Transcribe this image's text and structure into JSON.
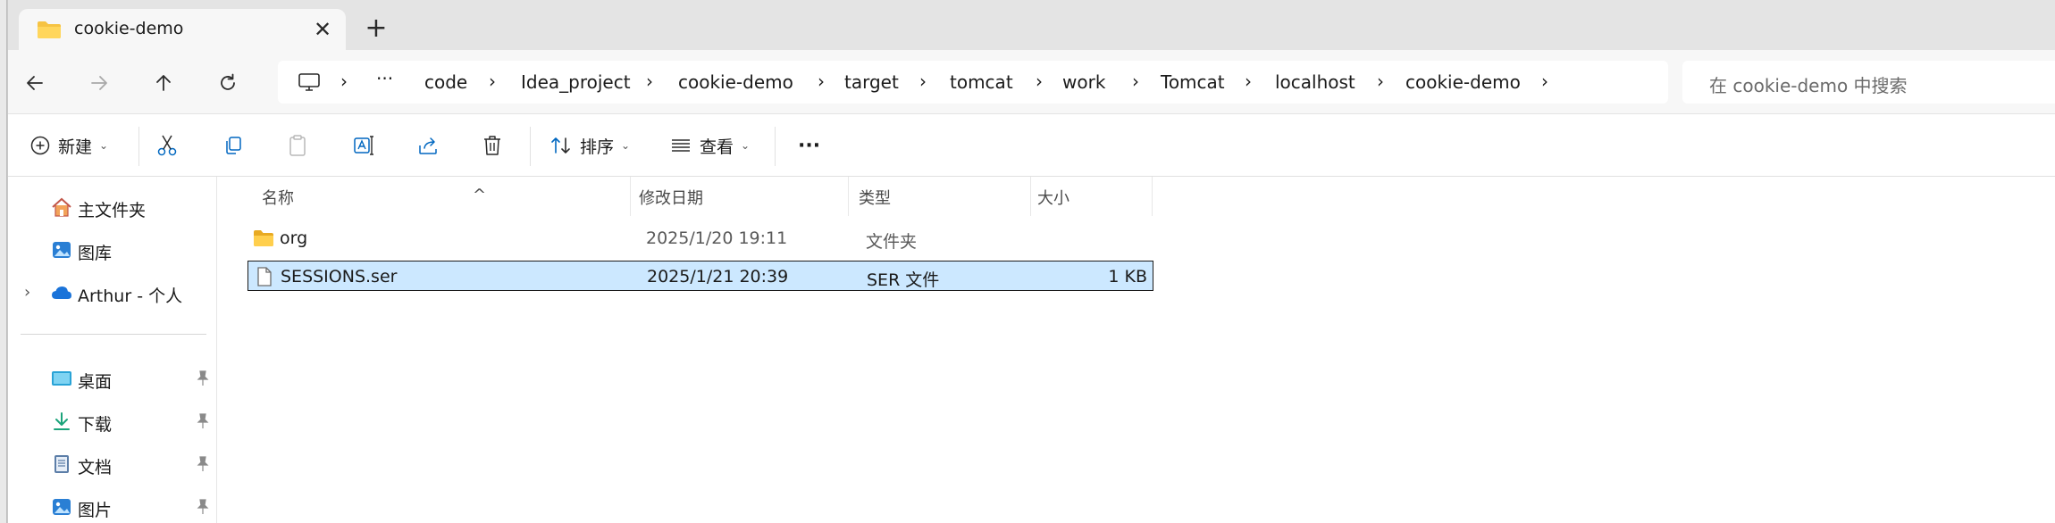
{
  "tab": {
    "title": "cookie-demo",
    "close_glyph": "✕",
    "new_tab_glyph": "+"
  },
  "nav": {
    "back_icon": "arrow-left-icon",
    "forward_icon": "arrow-right-icon",
    "up_icon": "arrow-up-icon",
    "refresh_icon": "refresh-icon"
  },
  "address": {
    "overflow": "···",
    "separator": "›",
    "crumbs": [
      "code",
      "Idea_project",
      "cookie-demo",
      "target",
      "tomcat",
      "work",
      "Tomcat",
      "localhost",
      "cookie-demo"
    ]
  },
  "search": {
    "placeholder": "在 cookie-demo 中搜索"
  },
  "commands": {
    "new_label": "新建",
    "sort_label": "排序",
    "view_label": "查看",
    "caret": "⌄",
    "more": "···"
  },
  "sidebar": {
    "items": [
      {
        "label": "主文件夹",
        "icon": "home-icon"
      },
      {
        "label": "图库",
        "icon": "gallery-icon"
      },
      {
        "label": "Arthur - 个人",
        "icon": "cloud-icon",
        "expand": "›"
      },
      {
        "label": "桌面",
        "icon": "desktop-icon",
        "pinned": true
      },
      {
        "label": "下载",
        "icon": "download-icon",
        "pinned": true
      },
      {
        "label": "文档",
        "icon": "document-icon",
        "pinned": true
      },
      {
        "label": "图片",
        "icon": "pictures-icon",
        "pinned": true
      }
    ]
  },
  "columns": {
    "name": "名称",
    "modified": "修改日期",
    "type": "类型",
    "size": "大小",
    "sort_glyph": "^"
  },
  "files": [
    {
      "name": "org",
      "modified": "2025/1/20 19:11",
      "type": "文件夹",
      "size": "",
      "icon": "folder-icon",
      "selected": false
    },
    {
      "name": "SESSIONS.ser",
      "modified": "2025/1/21 20:39",
      "type": "SER 文件",
      "size": "1 KB",
      "icon": "file-icon",
      "selected": true
    }
  ],
  "colors": {
    "accent": "#0067c0",
    "selection": "#cce8ff",
    "folder": "#f6c343",
    "tabbar": "#e4e4e4"
  }
}
